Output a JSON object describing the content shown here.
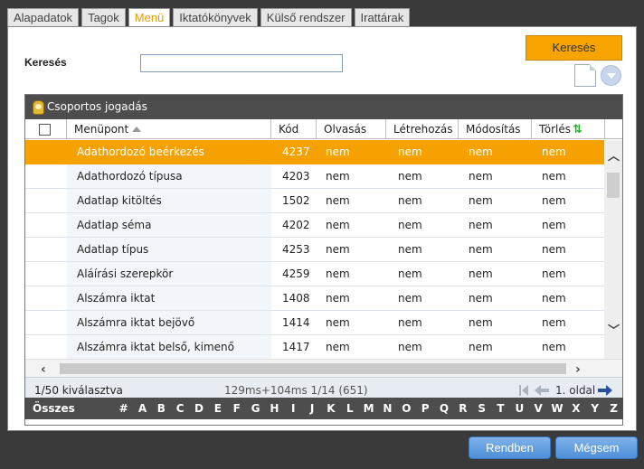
{
  "tabs": [
    {
      "label": "Alapadatok",
      "active": false
    },
    {
      "label": "Tagok",
      "active": false
    },
    {
      "label": "Menü",
      "active": true
    },
    {
      "label": "Iktatókönyvek",
      "active": false
    },
    {
      "label": "Külső rendszer",
      "active": false
    },
    {
      "label": "Irattárak",
      "active": false
    }
  ],
  "search": {
    "label": "Keresés",
    "value": "",
    "button_label": "Keresés"
  },
  "grid": {
    "title": "Csoportos jogadás",
    "columns": [
      "Menüpont",
      "Kód",
      "Olvasás",
      "Létrehozás",
      "Módosítás",
      "Törlés"
    ],
    "rows": [
      {
        "menupont": "Adathordozó beérkezés",
        "kod": "4237",
        "olvasas": "nem",
        "letrehozas": "nem",
        "modositas": "nem",
        "torles": "nem",
        "selected": true
      },
      {
        "menupont": "Adathordozó típusa",
        "kod": "4203",
        "olvasas": "nem",
        "letrehozas": "nem",
        "modositas": "nem",
        "torles": "nem",
        "selected": false
      },
      {
        "menupont": "Adatlap kitöltés",
        "kod": "1502",
        "olvasas": "nem",
        "letrehozas": "nem",
        "modositas": "nem",
        "torles": "nem",
        "selected": false
      },
      {
        "menupont": "Adatlap séma",
        "kod": "4202",
        "olvasas": "nem",
        "letrehozas": "nem",
        "modositas": "nem",
        "torles": "nem",
        "selected": false
      },
      {
        "menupont": "Adatlap típus",
        "kod": "4253",
        "olvasas": "nem",
        "letrehozas": "nem",
        "modositas": "nem",
        "torles": "nem",
        "selected": false
      },
      {
        "menupont": "Aláírási szerepkör",
        "kod": "4259",
        "olvasas": "nem",
        "letrehozas": "nem",
        "modositas": "nem",
        "torles": "nem",
        "selected": false
      },
      {
        "menupont": "Alszámra iktat",
        "kod": "1408",
        "olvasas": "nem",
        "letrehozas": "nem",
        "modositas": "nem",
        "torles": "nem",
        "selected": false
      },
      {
        "menupont": "Alszámra iktat bejövő",
        "kod": "1414",
        "olvasas": "nem",
        "letrehozas": "nem",
        "modositas": "nem",
        "torles": "nem",
        "selected": false
      },
      {
        "menupont": "Alszámra iktat belső, kimenő",
        "kod": "1417",
        "olvasas": "nem",
        "letrehozas": "nem",
        "modositas": "nem",
        "torles": "nem",
        "selected": false
      }
    ]
  },
  "status": {
    "selected": "1/50 kiválasztva",
    "timing": "129ms+104ms 1/14 (651)",
    "page": "1. oldal"
  },
  "alphabet": {
    "all_label": "Összes",
    "letters": [
      "#",
      "A",
      "B",
      "C",
      "D",
      "E",
      "F",
      "G",
      "H",
      "I",
      "J",
      "K",
      "L",
      "M",
      "N",
      "O",
      "P",
      "Q",
      "R",
      "S",
      "T",
      "U",
      "V",
      "W",
      "X",
      "Y",
      "Z"
    ]
  },
  "footer": {
    "ok_label": "Rendben",
    "cancel_label": "Mégsem"
  },
  "colors": {
    "accent": "#f5a200",
    "header_bar": "#4d4d4d",
    "button_blue": "#5b9ae0"
  }
}
